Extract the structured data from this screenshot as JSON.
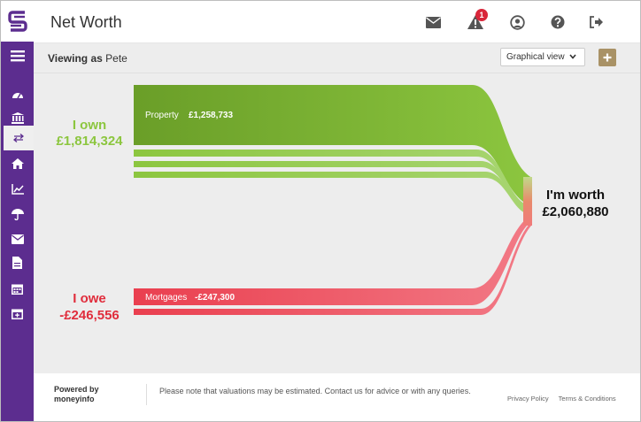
{
  "header": {
    "title": "Net Worth",
    "alerts_count": "1"
  },
  "subbar": {
    "viewing_label": "Viewing as",
    "user": "Pete",
    "view_select": "Graphical view"
  },
  "sankey": {
    "own_label": "I own",
    "own_value": "£1,814,324",
    "owe_label": "I owe",
    "owe_value": "-£246,556",
    "worth_label": "I'm worth",
    "worth_value": "£2,060,880",
    "property_label": "Property",
    "property_value": "£1,258,733",
    "mortgage_label": "Mortgages",
    "mortgage_value": "-£247,300",
    "colors": {
      "own": "#7ab530",
      "owe": "#e02d3c",
      "worth": "#e88a6c"
    }
  },
  "footer": {
    "powered_line1": "Powered by",
    "powered_line2": "moneyinfo",
    "note": "Please note that valuations may be estimated. Contact us for advice or with any queries.",
    "privacy": "Privacy Policy",
    "terms": "Terms & Conditions"
  },
  "icons": [
    "logo-icon",
    "menu-icon",
    "dashboard-icon",
    "bank-icon",
    "transfer-icon",
    "home-icon",
    "chart-icon",
    "umbrella-icon",
    "mail-icon",
    "document-icon",
    "calendar-icon",
    "calendar-plus-icon",
    "envelope-icon",
    "alert-icon",
    "user-icon",
    "help-icon",
    "logout-icon"
  ]
}
